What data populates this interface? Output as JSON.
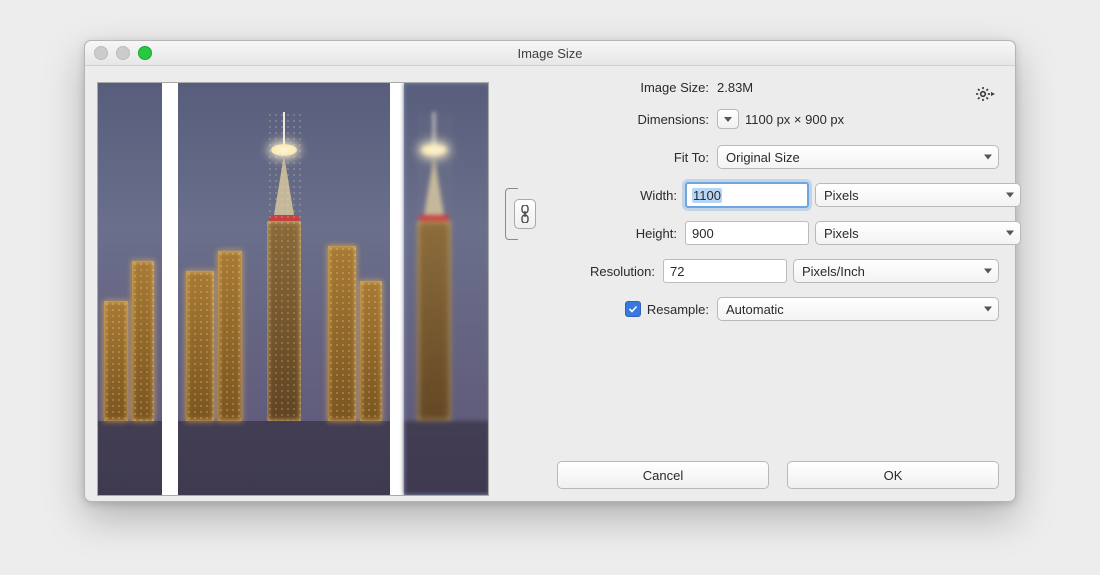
{
  "window": {
    "title": "Image Size"
  },
  "image_size": {
    "label": "Image Size:",
    "value": "2.83M"
  },
  "dimensions": {
    "label": "Dimensions:",
    "value": "1100 px  ×  900 px"
  },
  "fit_to": {
    "label": "Fit To:",
    "value": "Original Size"
  },
  "width": {
    "label": "Width:",
    "value": "1100",
    "units": "Pixels"
  },
  "height": {
    "label": "Height:",
    "value": "900",
    "units": "Pixels"
  },
  "resolution": {
    "label": "Resolution:",
    "value": "72",
    "units": "Pixels/Inch"
  },
  "resample": {
    "label": "Resample:",
    "checked": true,
    "value": "Automatic"
  },
  "buttons": {
    "cancel": "Cancel",
    "ok": "OK"
  }
}
